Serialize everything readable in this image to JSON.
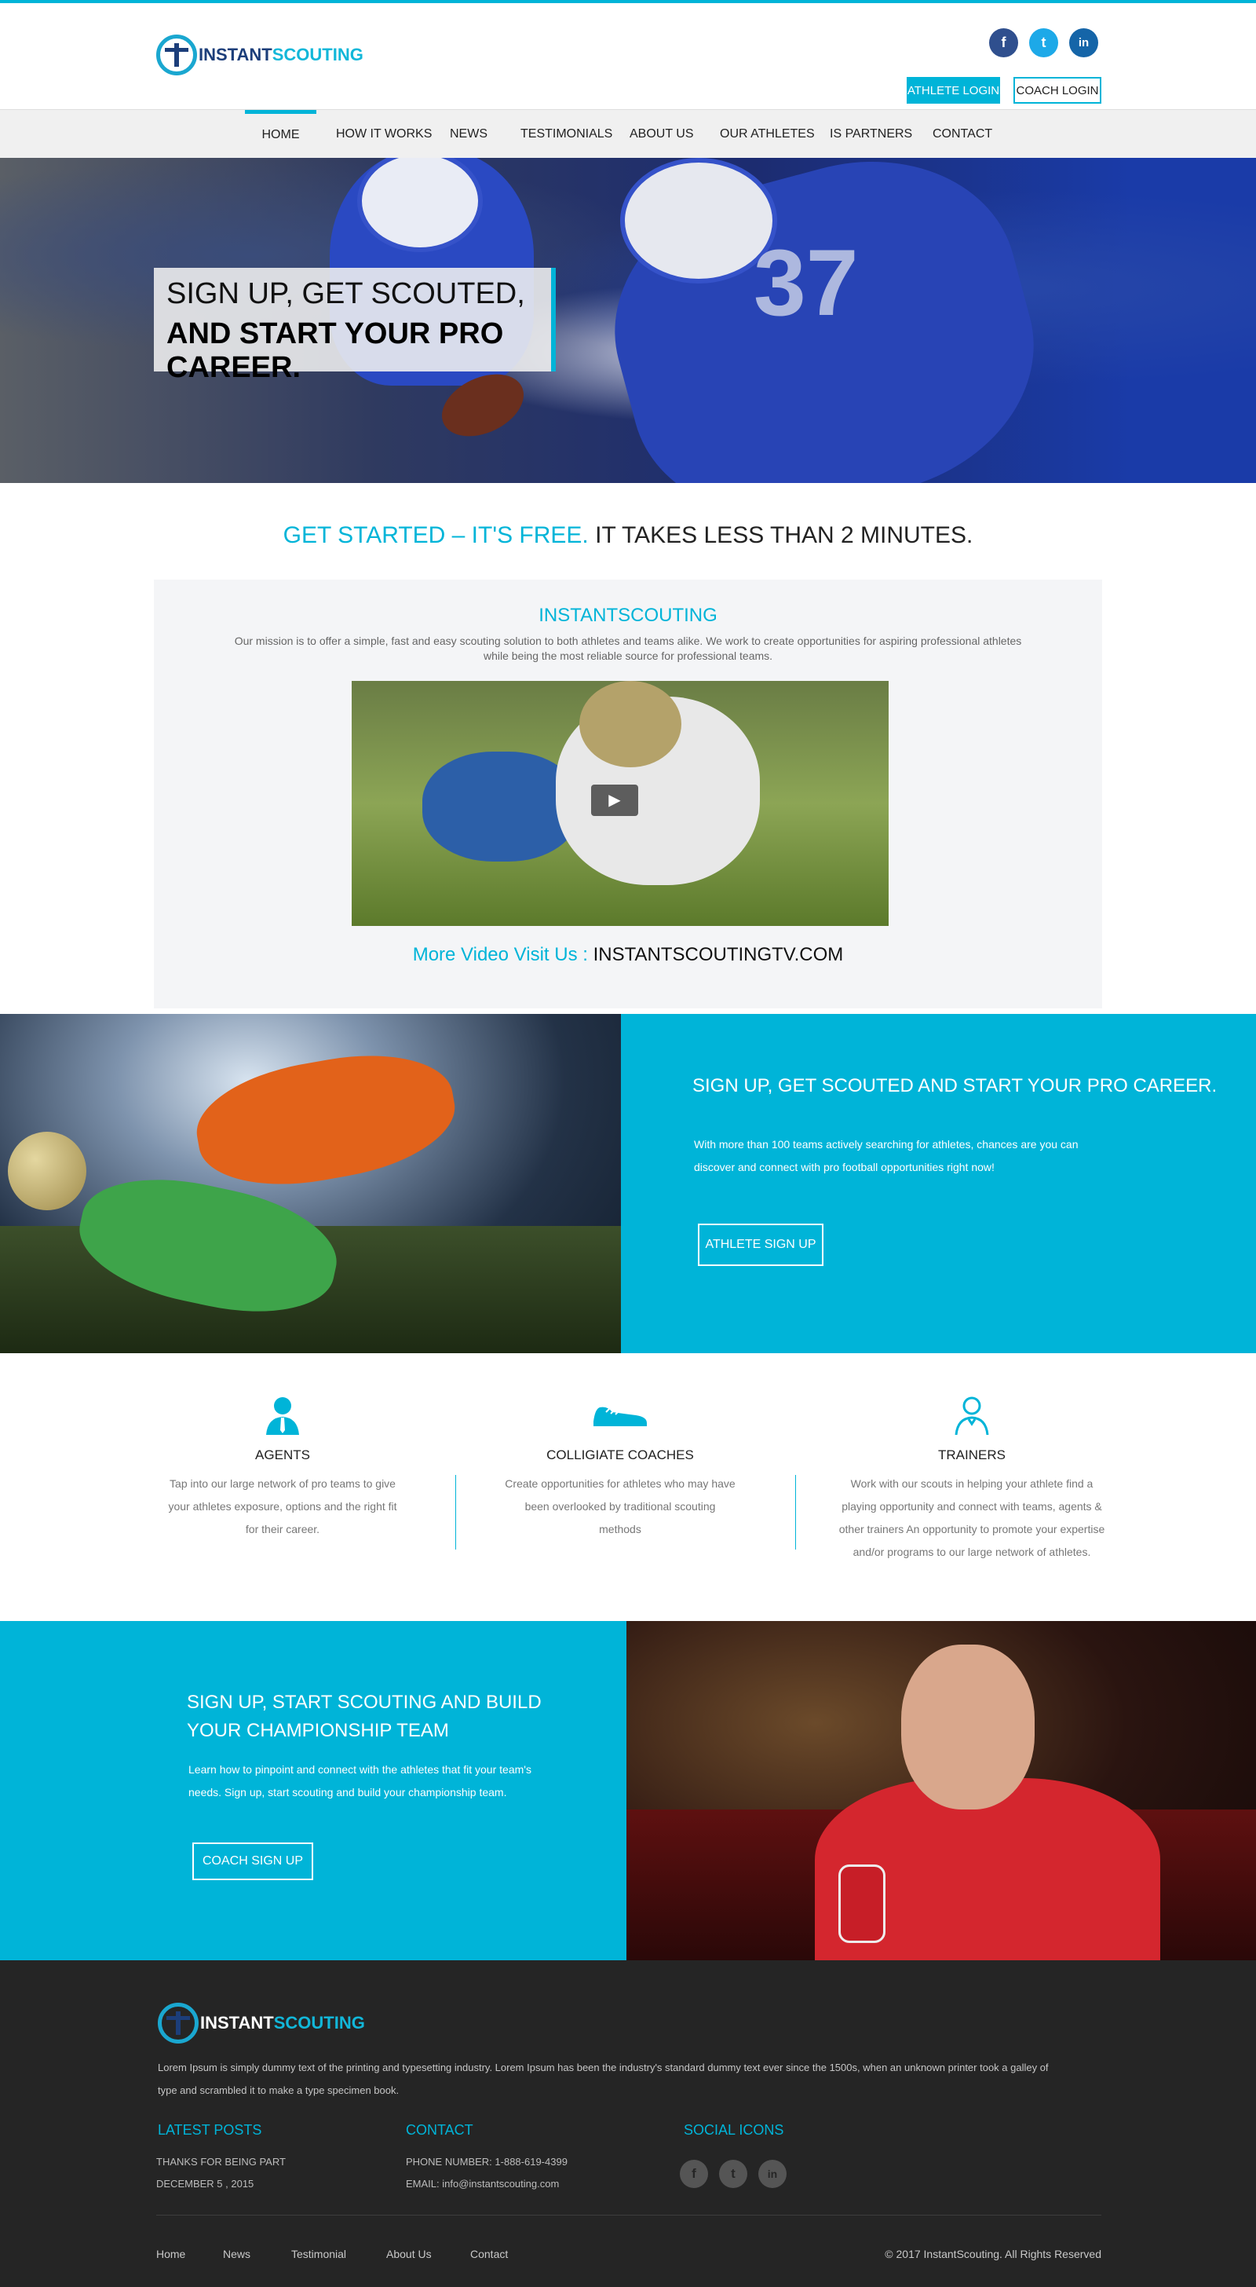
{
  "brand": {
    "logo_a": "INSTANT",
    "logo_b": "SCOUTING",
    "accent": "#00b4d8",
    "dark": "#1c3e7a"
  },
  "top_social": [
    {
      "icon": "facebook-icon",
      "glyph": "f",
      "color": "#2f4f8e"
    },
    {
      "icon": "twitter-icon",
      "glyph": "t",
      "color": "#1da9e8"
    },
    {
      "icon": "linkedin-icon",
      "glyph": "in",
      "color": "#1565a8"
    }
  ],
  "login": {
    "athlete": "ATHLETE LOGIN",
    "coach": "COACH LOGIN"
  },
  "nav": [
    "HOME",
    "HOW IT WORKS",
    "NEWS",
    "TESTIMONIALS",
    "ABOUT US",
    "OUR ATHLETES",
    "IS PARTNERS",
    "CONTACT"
  ],
  "hero": {
    "line1": "SIGN UP, GET SCOUTED,",
    "line2": "AND START YOUR PRO CAREER.",
    "jersey": "37"
  },
  "started": {
    "colored": "GET STARTED – IT'S FREE.",
    "dark": "IT TAKES LESS THAN 2 MINUTES."
  },
  "mission": {
    "title": "INSTANTSCOUTING",
    "text": "Our mission is to offer a simple, fast and easy scouting solution to both athletes and teams alike. We work to create opportunities for aspiring professional athletes while being the most reliable source for professional teams.",
    "more_label": "More Video Visit Us :",
    "more_link": "INSTANTSCOUTINGTV.COM"
  },
  "athlete_section": {
    "title": "SIGN UP, GET SCOUTED AND START YOUR PRO CAREER.",
    "text": "With more than 100 teams actively searching for athletes, chances are you can discover and connect with pro football opportunities right now!",
    "button": "ATHLETE SIGN UP"
  },
  "features": [
    {
      "icon": "agent-person-icon",
      "title": "AGENTS",
      "text": "Tap into our large network of pro teams to give your athletes exposure, options and the right fit for their career."
    },
    {
      "icon": "sneaker-icon",
      "title": "COLLIGIATE COACHES",
      "text": "Create opportunities for athletes who may have been overlooked by traditional scouting methods"
    },
    {
      "icon": "trainer-person-icon",
      "title": "TRAINERS",
      "text": "Work with our scouts in helping your athlete find a playing opportunity and connect with teams, agents & other trainers An opportunity to promote your expertise and/or programs to our large network of athletes."
    }
  ],
  "coach_section": {
    "title": "SIGN UP, START SCOUTING AND BUILD YOUR CHAMPIONSHIP TEAM",
    "text": "Learn how to pinpoint and connect with the athletes that fit your team's needs. Sign up, start scouting and build your championship team.",
    "button": "COACH SIGN UP"
  },
  "footer": {
    "intro": "Lorem Ipsum is simply dummy text of the printing and typesetting industry. Lorem Ipsum has been the industry's standard dummy text ever since the 1500s, when an unknown printer took a galley of type and scrambled it to make a type specimen book.",
    "latest_title": "LATEST POSTS",
    "latest_post": "THANKS FOR BEING PART",
    "latest_date": "DECEMBER 5 , 2015",
    "contact_title": "CONTACT",
    "phone": "PHONE NUMBER: 1-888-619-4399",
    "email": "EMAIL: info@instantscouting.com",
    "social_title": "SOCIAL ICONS",
    "nav": [
      "Home",
      "News",
      "Testimonial",
      "About Us",
      "Contact"
    ],
    "copyright": "© 2017 InstantScouting. All Rights Reserved"
  }
}
